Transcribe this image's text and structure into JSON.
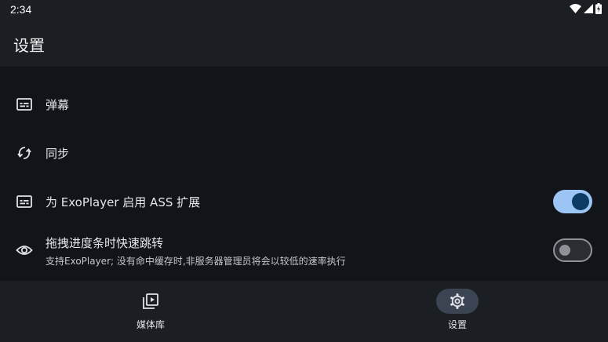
{
  "status_bar": {
    "time": "2:34",
    "icons": [
      "wifi-icon",
      "signal-icon",
      "battery-icon"
    ]
  },
  "app_bar": {
    "title": "设置"
  },
  "settings": [
    {
      "icon": "subtitles-icon",
      "label": "弹幕"
    },
    {
      "icon": "sync-icon",
      "label": "同步"
    },
    {
      "icon": "subtitles-icon",
      "label": "为 ExoPlayer 启用 ASS 扩展",
      "toggle": true
    },
    {
      "icon": "eye-icon",
      "label": "拖拽进度条时快速跳转",
      "sub": "支持ExoPlayer; 没有命中缓存时,非服务器管理员将会以较低的速率执行",
      "toggle": false
    }
  ],
  "bottom_nav": [
    {
      "icon": "media-library-icon",
      "label": "媒体库",
      "active": false
    },
    {
      "icon": "gear-icon",
      "label": "设置",
      "active": true
    }
  ],
  "colors": {
    "background": "#111418",
    "surface": "#1b1e22",
    "switch_on_track": "#9cc5f6",
    "switch_on_knob": "#0d3a63",
    "nav_active_pill": "#3a4452"
  }
}
